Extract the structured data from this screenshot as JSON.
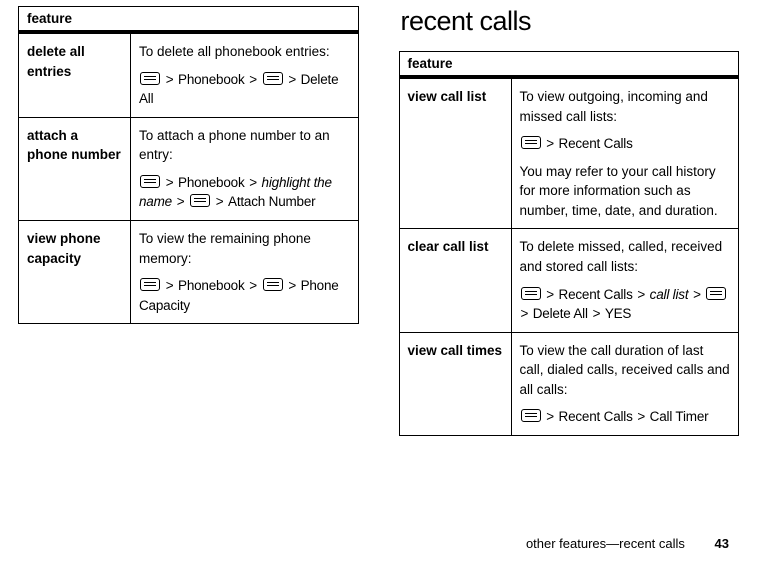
{
  "left": {
    "header": "feature",
    "rows": [
      {
        "name": "delete all entries",
        "desc": "To delete all phonebook entries:",
        "nav": [
          "[M]",
          ">",
          "Phonebook",
          ">",
          "[M]",
          ">",
          "Delete All"
        ]
      },
      {
        "name": "attach a phone number",
        "desc": "To attach a phone number to an entry:",
        "nav": [
          "[M]",
          ">",
          "Phonebook",
          ">",
          "highlight the name",
          ">",
          "[M]",
          ">",
          "Attach Number"
        ]
      },
      {
        "name": "view phone capacity",
        "desc": "To view the remaining phone memory:",
        "nav": [
          "[M]",
          ">",
          "Phonebook",
          ">",
          "[M]",
          ">",
          "Phone Capacity"
        ]
      }
    ]
  },
  "right": {
    "title": "recent calls",
    "header": "feature",
    "rows": [
      {
        "name": "view call list",
        "desc": "To view outgoing, incoming and missed call lists:",
        "nav": [
          "[M]",
          ">",
          "Recent Calls"
        ],
        "desc2": "You may refer to your call history for more information such as number, time, date, and duration."
      },
      {
        "name": "clear call list",
        "desc": "To delete missed, called, received and stored call lists:",
        "nav": [
          "[M]",
          ">",
          "Recent Calls",
          ">",
          "call list",
          ">",
          "[M]",
          ">",
          "Delete All",
          ">",
          "YES"
        ]
      },
      {
        "name": "view call times",
        "desc": "To view the call duration of last call, dialed calls, received calls and all calls:",
        "nav": [
          "[M]",
          ">",
          "Recent Calls",
          ">",
          "Call Timer"
        ]
      }
    ]
  },
  "footer": {
    "text": "other features—recent calls",
    "page": "43"
  },
  "italic_tokens": [
    "highlight the name",
    "call list"
  ]
}
